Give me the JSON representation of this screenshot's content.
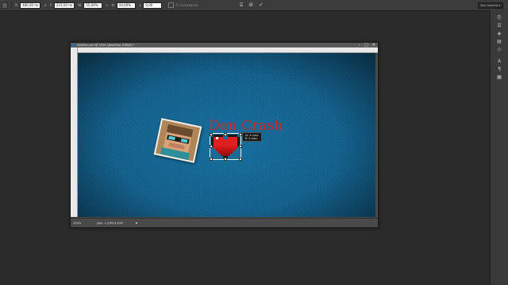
{
  "options_bar": {
    "x_label": "X:",
    "x_value": "480,00 пк",
    "y_label": "Y:",
    "y_value": "223,50 пк",
    "w_label": "W:",
    "w_value": "55,00%",
    "h_label": "H:",
    "h_value": "44,00%",
    "angle_label": "∠",
    "angle_value": "0,00",
    "interp_label": "Сглаживание"
  },
  "workspace": {
    "label": "Все панели ▾"
  },
  "document": {
    "title": "wallstrm.psd @ 100% (Ден/Кош, RGB/8) *",
    "ruler_ticks": [
      "0",
      "50",
      "100",
      "150",
      "200",
      "250",
      "300",
      "350",
      "400",
      "450",
      "500",
      "550",
      "600",
      "650",
      "700",
      "750",
      "800",
      "850",
      "900",
      "950",
      "1000"
    ],
    "zoom": "100%",
    "doc_size": "Док: 1,29М/3,49М"
  },
  "canvas_text": {
    "headline": "Den Crash"
  },
  "transform_tooltip": {
    "w": "Ш: 4 пикс.",
    "h": "В: 4 пикс."
  },
  "colors": {
    "headline": "#cc2a22",
    "canvas_bg": "#0f5a86",
    "app_bg": "#2b2b2b"
  },
  "panel_icons": [
    "history-icon",
    "properties-icon",
    "layers-icon",
    "channels-icon",
    "paths-icon",
    "character-icon",
    "paragraph-icon",
    "adjustments-icon"
  ]
}
